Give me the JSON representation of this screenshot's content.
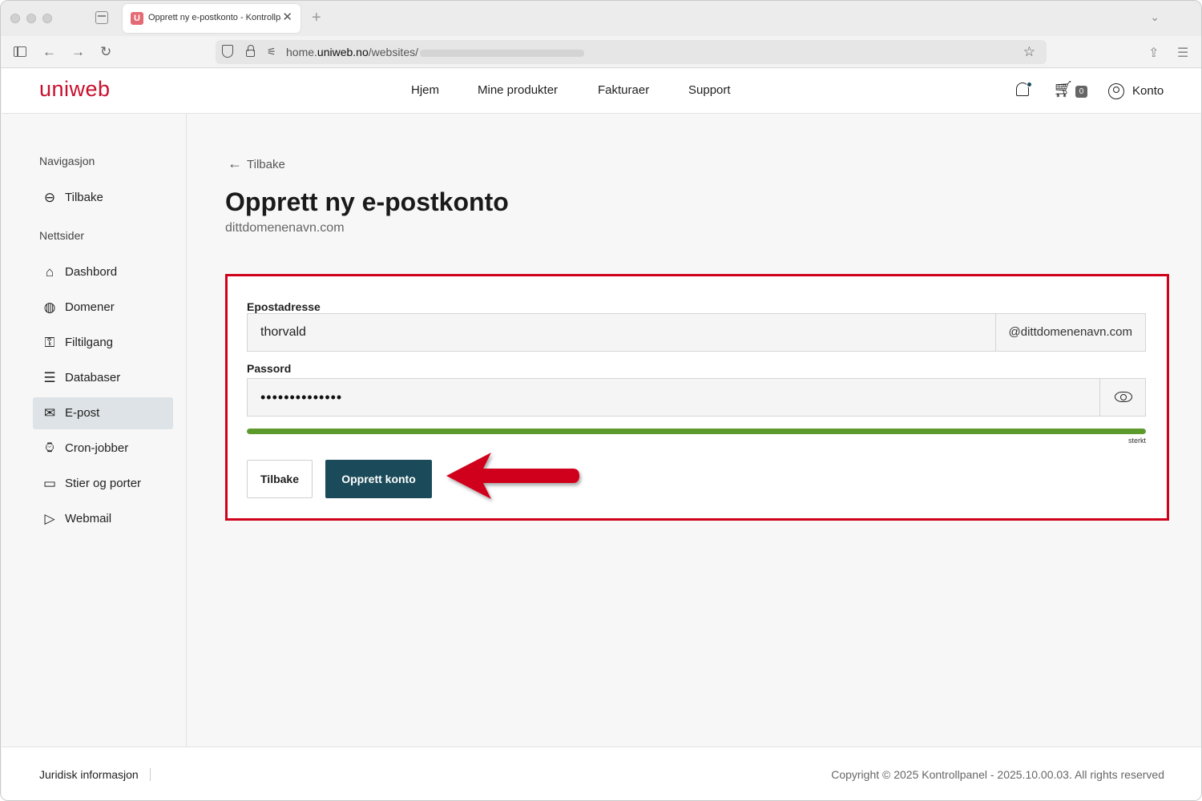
{
  "browser": {
    "tab_title": "Opprett ny e-postkonto - Kontrollpanel",
    "tab_favicon": "U",
    "url_prefix": "home.",
    "url_domain": "uniweb.no",
    "url_path": "/websites/",
    "new_tab": "+",
    "close": "✕"
  },
  "header": {
    "logo": "uniweb",
    "nav": [
      "Hjem",
      "Mine produkter",
      "Fakturaer",
      "Support"
    ],
    "cart_count": "0",
    "account": "Konto"
  },
  "sidebar": {
    "heading_nav": "Navigasjon",
    "back": "Tilbake",
    "heading_sites": "Nettsider",
    "items": [
      {
        "label": "Dashbord",
        "icon": "home-icon"
      },
      {
        "label": "Domener",
        "icon": "globe-icon"
      },
      {
        "label": "Filtilgang",
        "icon": "key-icon"
      },
      {
        "label": "Databaser",
        "icon": "database-icon"
      },
      {
        "label": "E-post",
        "icon": "mail-icon"
      },
      {
        "label": "Cron-jobber",
        "icon": "watch-icon"
      },
      {
        "label": "Stier og porter",
        "icon": "folder-icon"
      },
      {
        "label": "Webmail",
        "icon": "send-icon"
      }
    ],
    "active_index": 4
  },
  "main": {
    "back_link": "Tilbake",
    "title": "Opprett ny e-postkonto",
    "subtitle": "dittdomenenavn.com",
    "form": {
      "email_label": "Epostadresse",
      "email_value": "thorvald",
      "email_suffix": "@dittdomenenavn.com",
      "password_label": "Passord",
      "password_masked": "••••••••••••••",
      "strength_fraction": 1.0,
      "strength_label": "sterkt",
      "cancel_button": "Tilbake",
      "submit_button": "Opprett konto"
    },
    "annotation_color": "#d0021b"
  },
  "footer": {
    "legal": "Juridisk informasjon",
    "copyright": "Copyright © 2025 Kontrollpanel - 2025.10.00.03. All rights reserved"
  },
  "colors": {
    "brand": "#c8102e",
    "primary": "#1b4b5a",
    "strength": "#5c9a2b"
  }
}
